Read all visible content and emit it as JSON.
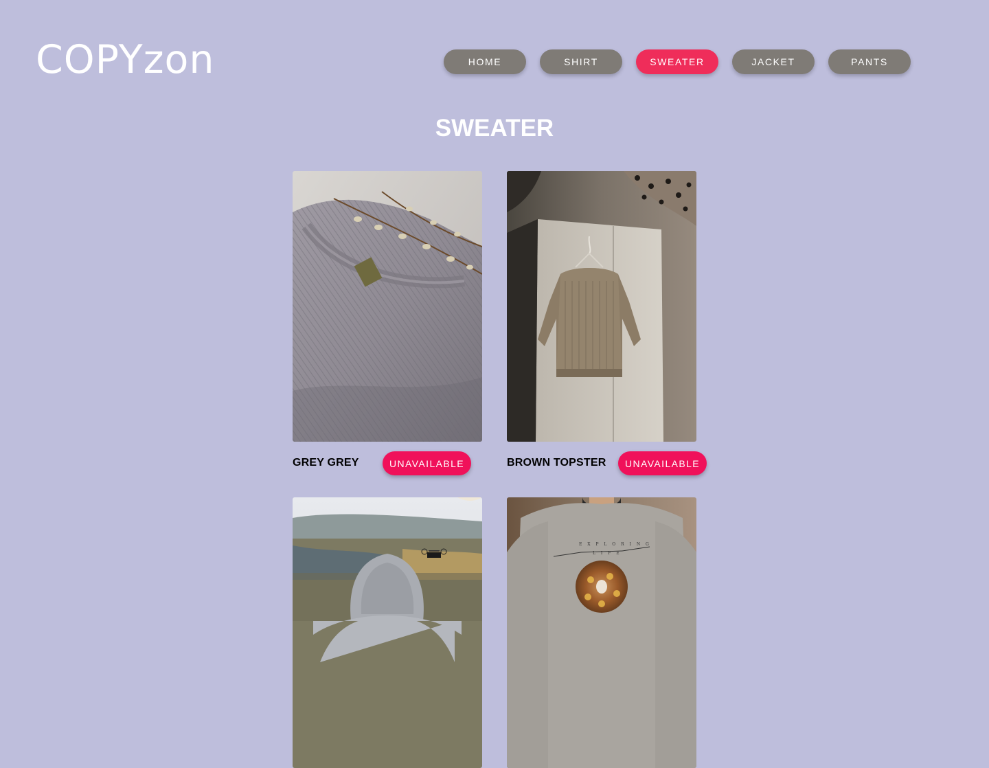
{
  "logo": "COPYzon",
  "nav": {
    "items": [
      {
        "label": "HOME",
        "active": false
      },
      {
        "label": "SHIRT",
        "active": false
      },
      {
        "label": "SWEATER",
        "active": true
      },
      {
        "label": "JACKET",
        "active": false
      },
      {
        "label": "PANTS",
        "active": false
      }
    ]
  },
  "page_title": "SWEATER",
  "products": [
    {
      "name": "GREY GREY",
      "status": "UNAVAILABLE",
      "image": "grey-knit-sweater-with-willow-branch"
    },
    {
      "name": "BROWN TOPSTER",
      "status": "UNAVAILABLE",
      "image": "brown-knit-sweater-on-hanger"
    },
    {
      "name": "",
      "status": "",
      "image": "person-in-grey-hoodie-with-drone"
    },
    {
      "name": "",
      "status": "",
      "image": "grey-sweatshirt-exploring-life-print"
    }
  ],
  "colors": {
    "background": "#bebedc",
    "nav_default": "#7f7b76",
    "nav_active": "#ef2d5a",
    "status_button": "#f0115a"
  }
}
